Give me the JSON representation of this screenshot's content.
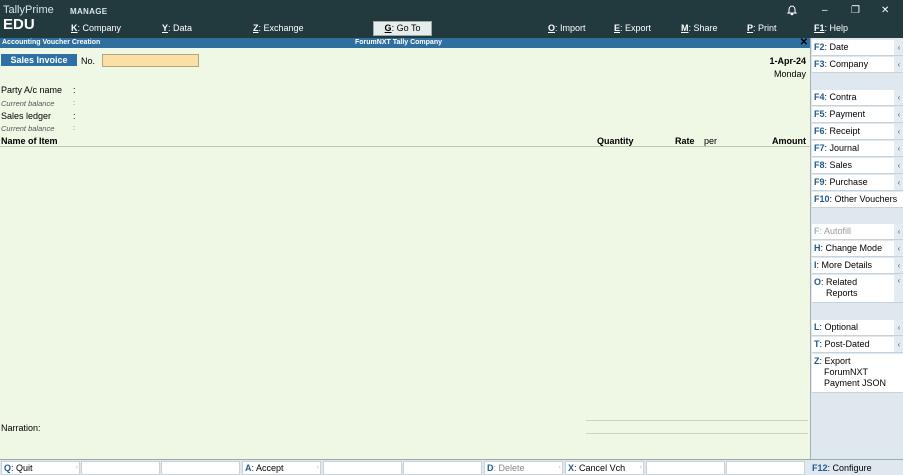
{
  "brand": {
    "name": "TallyPrime",
    "edition": "EDU"
  },
  "manage_label": "MANAGE",
  "menu": [
    {
      "key": "K",
      "label": "Company"
    },
    {
      "key": "Y",
      "label": "Data"
    },
    {
      "key": "Z",
      "label": "Exchange"
    },
    {
      "key": "G",
      "label": "Go To"
    },
    {
      "key": "O",
      "label": "Import"
    },
    {
      "key": "E",
      "label": "Export"
    },
    {
      "key": "M",
      "label": "Share"
    },
    {
      "key": "P",
      "label": "Print"
    },
    {
      "key": "F1",
      "label": "Help"
    }
  ],
  "window_controls": {
    "bell": "bell-icon",
    "minimize": "–",
    "restore": "❐",
    "close": "✕"
  },
  "titlebar": {
    "left": "Accounting Voucher Creation",
    "center": "ForumNXT Tally Company",
    "close": "✕"
  },
  "voucher": {
    "type": "Sales Invoice",
    "no_label": "No.",
    "no_value": "",
    "date": "1-Apr-24",
    "day": "Monday",
    "party_label": "Party A/c name",
    "current_balance_label": "Current balance",
    "sales_ledger_label": "Sales ledger",
    "colon": ":",
    "columns": {
      "item": "Name of Item",
      "quantity": "Quantity",
      "rate": "Rate",
      "per": "per",
      "amount": "Amount"
    },
    "narration_label": "Narration:"
  },
  "right_panel": [
    {
      "key": "F2",
      "label": "Date",
      "enabled": true
    },
    {
      "key": "F3",
      "label": "Company",
      "enabled": true
    },
    {
      "key": "F4",
      "label": "Contra",
      "enabled": true
    },
    {
      "key": "F5",
      "label": "Payment",
      "enabled": true
    },
    {
      "key": "F6",
      "label": "Receipt",
      "enabled": true
    },
    {
      "key": "F7",
      "label": "Journal",
      "enabled": true
    },
    {
      "key": "F8",
      "label": "Sales",
      "enabled": true
    },
    {
      "key": "F9",
      "label": "Purchase",
      "enabled": true
    },
    {
      "key": "F10",
      "label": "Other Vouchers",
      "enabled": true
    },
    {
      "key": "F",
      "label": "Autofill",
      "enabled": false
    },
    {
      "key": "H",
      "label": "Change Mode",
      "enabled": true
    },
    {
      "key": "I",
      "label": "More Details",
      "enabled": true
    },
    {
      "key": "O",
      "label": "Related",
      "label2": "Reports",
      "enabled": true
    },
    {
      "key": "L",
      "label": "Optional",
      "enabled": true
    },
    {
      "key": "T",
      "label": "Post-Dated",
      "enabled": true
    },
    {
      "key": "Z",
      "label": "Export",
      "label2": "ForumNXT",
      "label3": "Payment JSON",
      "enabled": true
    }
  ],
  "bottom_bar": [
    {
      "key": "Q",
      "label": "Quit",
      "enabled": true
    },
    {
      "key": "",
      "label": "",
      "enabled": false
    },
    {
      "key": "",
      "label": "",
      "enabled": false
    },
    {
      "key": "A",
      "label": "Accept",
      "enabled": true
    },
    {
      "key": "",
      "label": "",
      "enabled": false
    },
    {
      "key": "",
      "label": "",
      "enabled": false
    },
    {
      "key": "D",
      "label": "Delete",
      "enabled": false
    },
    {
      "key": "X",
      "label": "Cancel Vch",
      "enabled": true
    },
    {
      "key": "",
      "label": "",
      "enabled": false
    },
    {
      "key": "",
      "label": "",
      "enabled": false
    }
  ],
  "bottom_right": {
    "key": "F12",
    "label": "Configure"
  },
  "arrow_glyph": "‹",
  "separator": ":"
}
